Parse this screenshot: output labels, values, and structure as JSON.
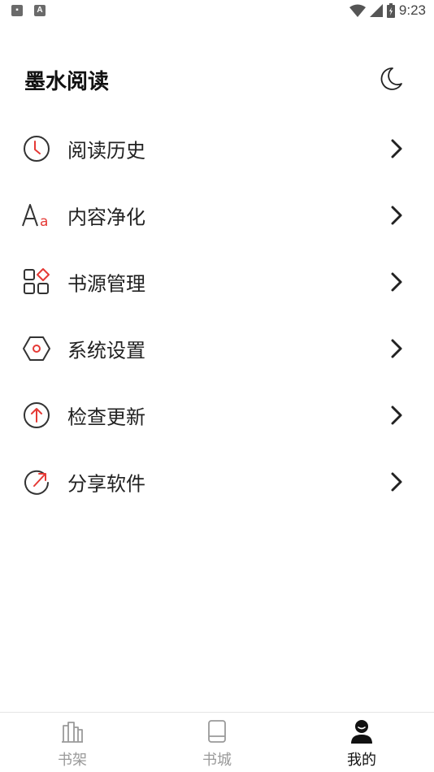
{
  "status_bar": {
    "time": "9:23"
  },
  "header": {
    "title": "墨水阅读"
  },
  "menu": [
    {
      "label": "阅读历史",
      "icon": "clock-icon"
    },
    {
      "label": "内容净化",
      "icon": "font-icon"
    },
    {
      "label": "书源管理",
      "icon": "grid-icon"
    },
    {
      "label": "系统设置",
      "icon": "hexagon-settings-icon"
    },
    {
      "label": "检查更新",
      "icon": "arrow-up-circle-icon"
    },
    {
      "label": "分享软件",
      "icon": "share-circle-icon"
    }
  ],
  "tabs": [
    {
      "label": "书架",
      "icon": "bookshelf-icon",
      "active": false
    },
    {
      "label": "书城",
      "icon": "book-icon",
      "active": false
    },
    {
      "label": "我的",
      "icon": "user-icon",
      "active": true
    }
  ],
  "colors": {
    "accent": "#e53935",
    "icon_gray": "#333333",
    "tab_inactive": "#9a9a9a"
  }
}
